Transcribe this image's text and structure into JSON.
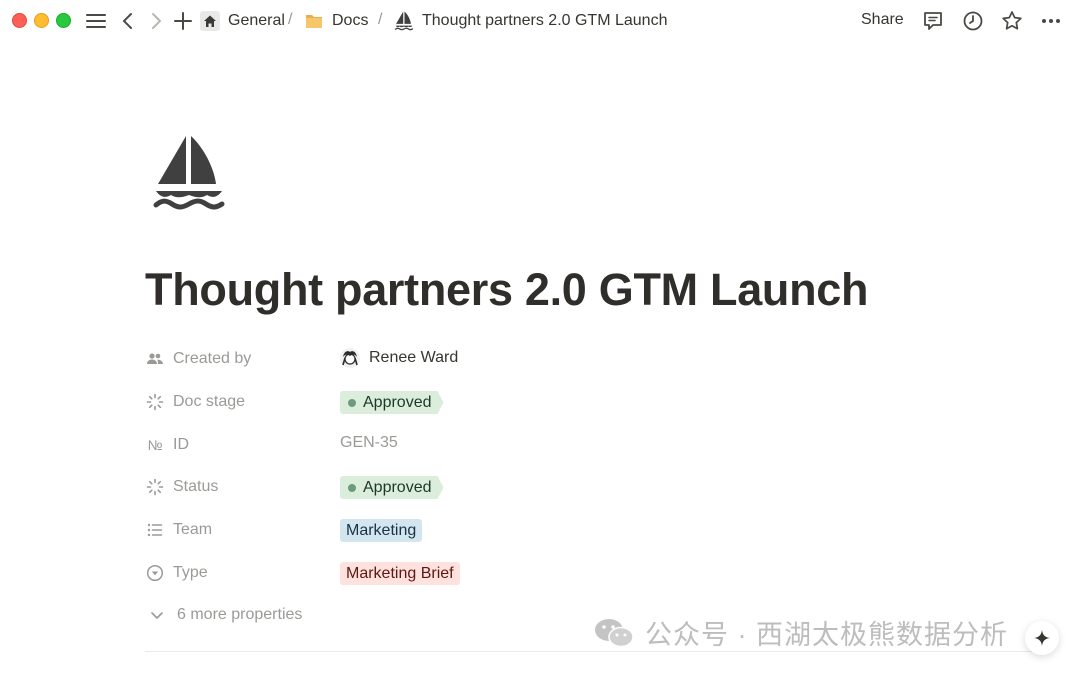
{
  "window": {
    "traffic_lights": [
      "close",
      "minimize",
      "maximize"
    ]
  },
  "breadcrumb": {
    "items": [
      {
        "icon": "home-icon",
        "label": "General"
      },
      {
        "icon": "folder-icon",
        "label": "Docs"
      },
      {
        "icon": "sailboat-icon",
        "label": "Thought partners 2.0 GTM Launch"
      }
    ],
    "separator": "/"
  },
  "toolbar": {
    "share_label": "Share",
    "icons": [
      "comment-icon",
      "history-icon",
      "star-icon",
      "more-icon"
    ]
  },
  "page": {
    "icon": "sailboat-icon",
    "title": "Thought partners 2.0 GTM Launch"
  },
  "properties": [
    {
      "icon": "people-icon",
      "label": "Created by",
      "value": "Renee Ward",
      "kind": "person"
    },
    {
      "icon": "status-icon",
      "label": "Doc stage",
      "value": "Approved",
      "kind": "status"
    },
    {
      "icon": "id-icon",
      "label": "ID",
      "value": "GEN-35",
      "kind": "id"
    },
    {
      "icon": "status-icon",
      "label": "Status",
      "value": "Approved",
      "kind": "status"
    },
    {
      "icon": "list-icon",
      "label": "Team",
      "value": "Marketing",
      "kind": "tag-blue"
    },
    {
      "icon": "select-icon",
      "label": "Type",
      "value": "Marketing Brief",
      "kind": "tag-red"
    }
  ],
  "id_prefix": "№",
  "more_properties": "6 more properties",
  "watermark": "公众号 · 西湖太极熊数据分析",
  "colors": {
    "status_bg": "#dbeddb",
    "status_dot": "#6c9b7d",
    "blue_tag_bg": "#d3e5ef",
    "red_tag_bg": "#ffe2dd"
  }
}
